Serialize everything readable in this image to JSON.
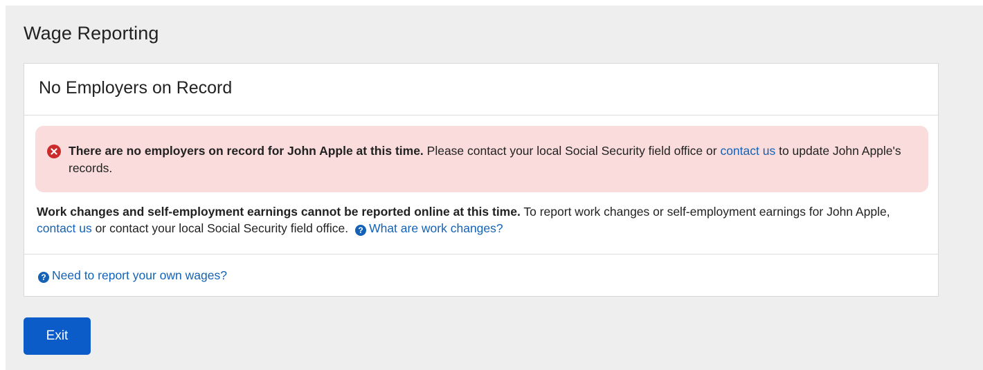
{
  "page": {
    "title": "Wage Reporting"
  },
  "card": {
    "title": "No Employers on Record",
    "alert": {
      "icon": "error-x-circle-icon",
      "strong_text": "There are no employers on record for John Apple at this time.",
      "text_before_link": " Please contact your local Social Security field office or ",
      "link_text": "contact us",
      "text_after_link": " to update John Apple's records."
    },
    "info": {
      "strong_text": "Work changes and self-employment earnings cannot be reported online at this time.",
      "text_before_link": " To report work changes or self-employment earnings for John Apple, ",
      "link_text": "contact us",
      "text_after_link": " or contact your local Social Security field office.",
      "help_link_icon": "question-circle-icon",
      "help_link_text": "What are work changes?"
    },
    "footer": {
      "help_link_icon": "question-circle-icon",
      "help_link_text": "Need to report your own wages?"
    }
  },
  "buttons": {
    "exit_label": "Exit"
  },
  "colors": {
    "accent": "#0b5bc8",
    "link": "#1462b5",
    "error": "#cc2b2b",
    "alert_background": "#fadcdc",
    "page_background": "#eeeeee"
  }
}
